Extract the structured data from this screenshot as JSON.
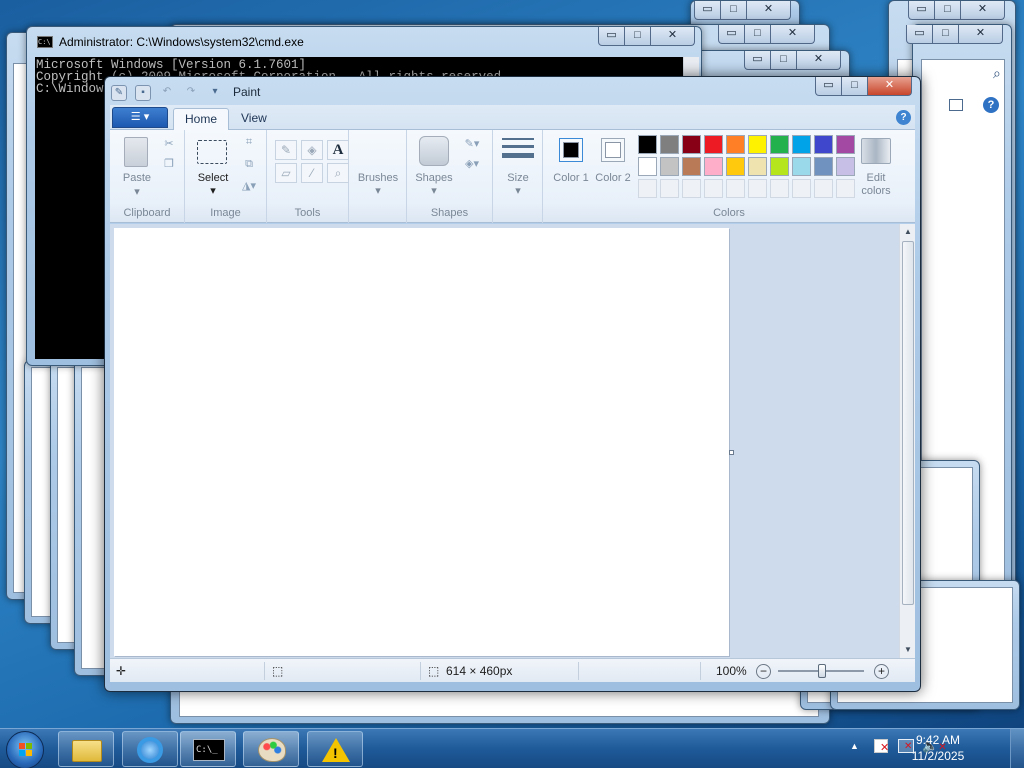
{
  "cmd": {
    "title": "Administrator: C:\\Windows\\system32\\cmd.exe",
    "lines": [
      "Microsoft Windows [Version 6.1.7601]",
      "Copyright (c) 2009 Microsoft Corporation.  All rights reserved.",
      "",
      "C:\\Window"
    ]
  },
  "caption_buttons": {
    "min": "▭",
    "max": "□",
    "close": "✕"
  },
  "paint": {
    "title": "Paint",
    "tabs": [
      "Home",
      "View"
    ],
    "app_menu": "▾",
    "help": "?",
    "groups": {
      "clipboard": {
        "label": "Clipboard",
        "paste": "Paste"
      },
      "image": {
        "label": "Image",
        "select": "Select"
      },
      "tools": {
        "label": "Tools"
      },
      "brushes": {
        "label": "Brushes"
      },
      "shapes": {
        "label": "Shapes",
        "shapes_btn": "Shapes"
      },
      "size": {
        "label": "Size"
      },
      "colors": {
        "label": "Colors",
        "color1": "Color 1",
        "color2": "Color 2",
        "edit": "Edit colors",
        "row1": [
          "#000000",
          "#7f7f7f",
          "#880015",
          "#ed1c24",
          "#ff7f27",
          "#fff200",
          "#22b14c",
          "#00a2e8",
          "#3f48cc",
          "#a349a4"
        ],
        "row2": [
          "#ffffff",
          "#c3c3c3",
          "#b97a57",
          "#ffaec9",
          "#ffc90e",
          "#efe4b0",
          "#b5e61d",
          "#99d9ea",
          "#7092be",
          "#c8bfe7"
        ]
      }
    },
    "status": {
      "image_size": "614 × 460px",
      "zoom": "100%"
    }
  },
  "taskbar": {
    "time": "9:42 AM",
    "date": "11/2/2025",
    "apps": [
      "Windows Explorer",
      "Internet Explorer",
      "Command Prompt",
      "Paint",
      "Warning"
    ]
  }
}
